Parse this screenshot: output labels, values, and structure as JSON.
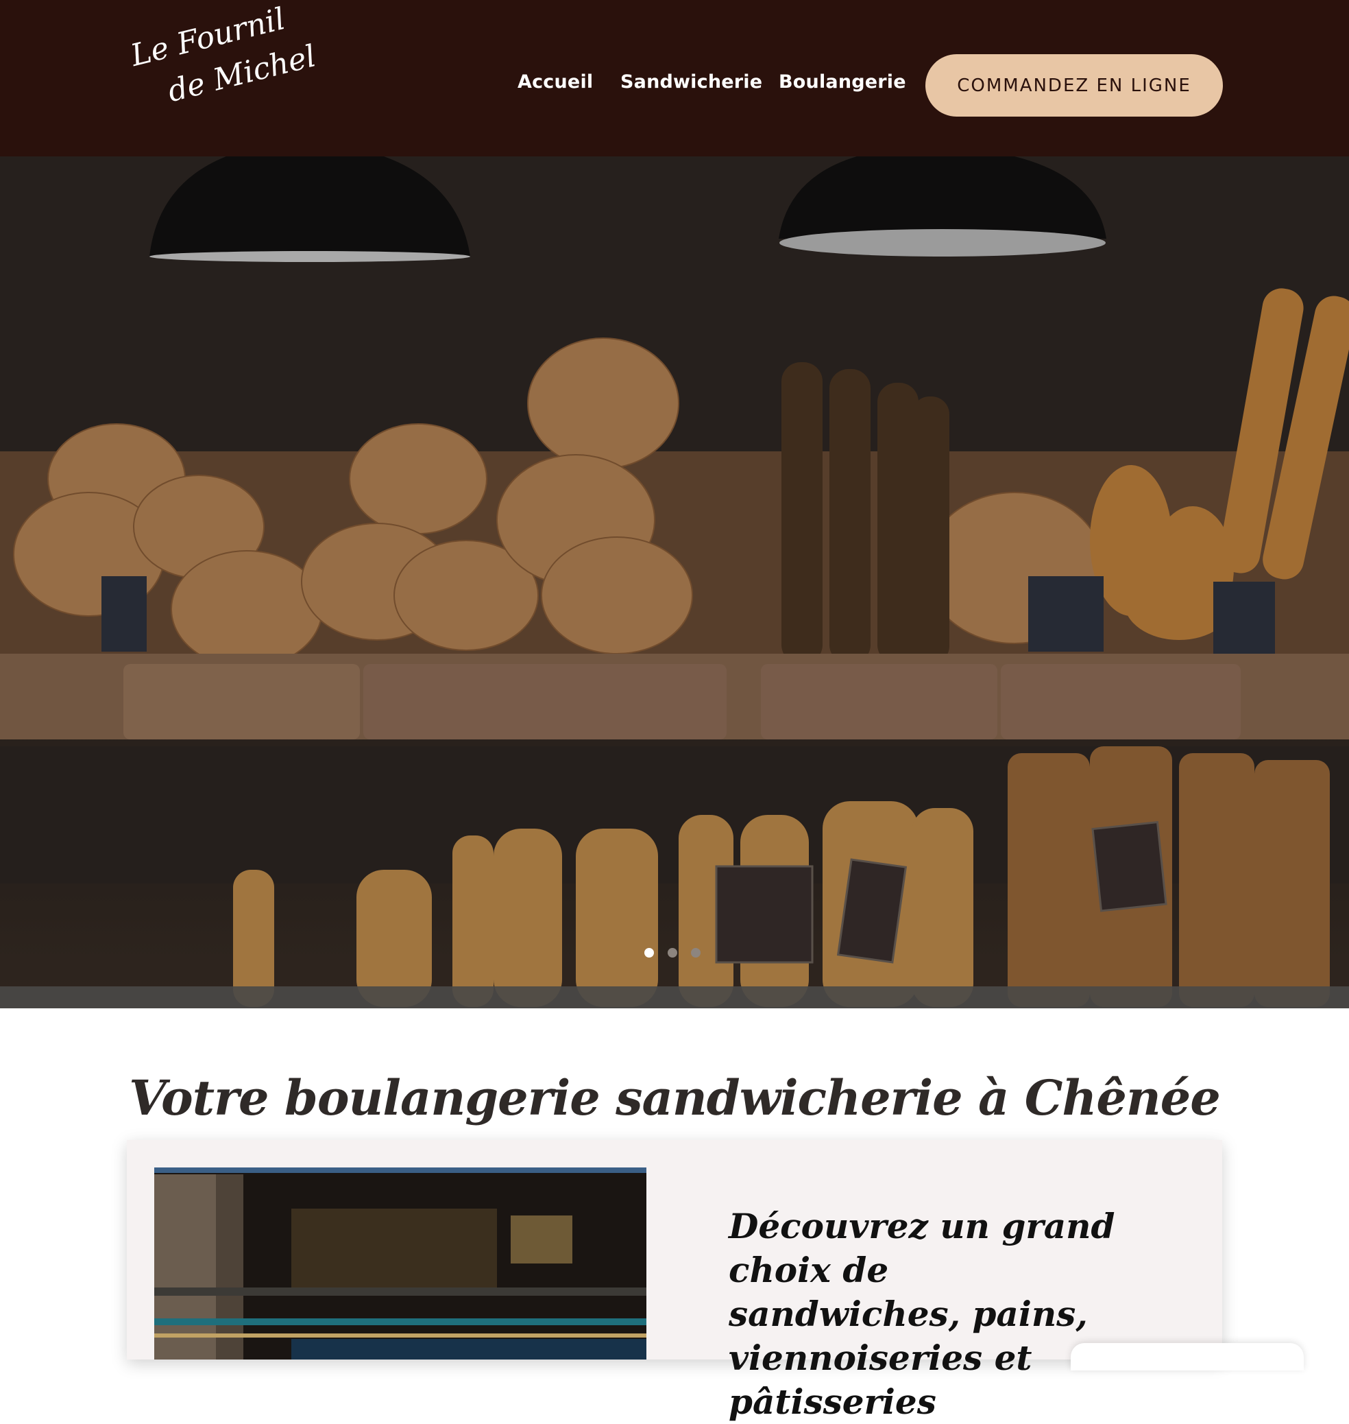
{
  "header": {
    "logo_line1": "Le Fournil",
    "logo_line2": "de Michel",
    "nav": [
      "Accueil",
      "Sandwicherie",
      "Boulangerie"
    ],
    "cta_label": "COMMANDEZ EN LIGNE"
  },
  "hero": {
    "slide_count": 3,
    "active_slide": 1
  },
  "main": {
    "title": "Votre boulangerie sandwicherie à Chênée",
    "card_heading_lines": [
      "Découvrez un grand choix de",
      "sandwiches, pains,",
      "viennoiseries et pâtisseries"
    ]
  },
  "colors": {
    "header_bg": "#2a110c",
    "cta_bg": "#e8c6a5",
    "title_text": "#2f2a28",
    "card_bg": "#f6f2f2"
  }
}
